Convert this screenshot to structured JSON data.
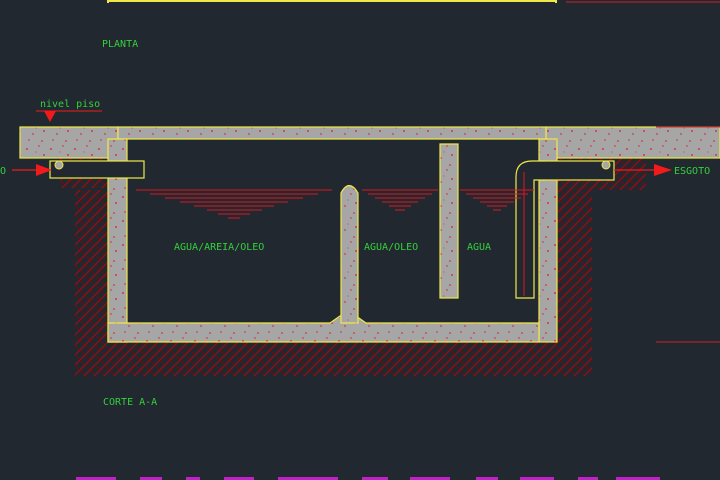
{
  "drawing": {
    "plan_title": "PLANTA",
    "section_title": "CORTE A-A",
    "floor_level_label": "nivel piso",
    "inlet_label": "O",
    "outlet_label": "ESGOTO",
    "chamber1_label": "AGUA/AREIA/OLEO",
    "chamber2_label": "AGUA/OLEO",
    "chamber3_label": "AGUA"
  },
  "colors": {
    "background": "#212830",
    "outline": "#f0e84a",
    "concrete": "#a6a6a6",
    "concrete_dots": "#e0161e",
    "earth_hatch": "#8a1016",
    "water": "#e0161e",
    "text": "#34d13a",
    "arrow": "#f21a1a",
    "dim_line": "#d0202a",
    "footer": "#c020c8"
  }
}
